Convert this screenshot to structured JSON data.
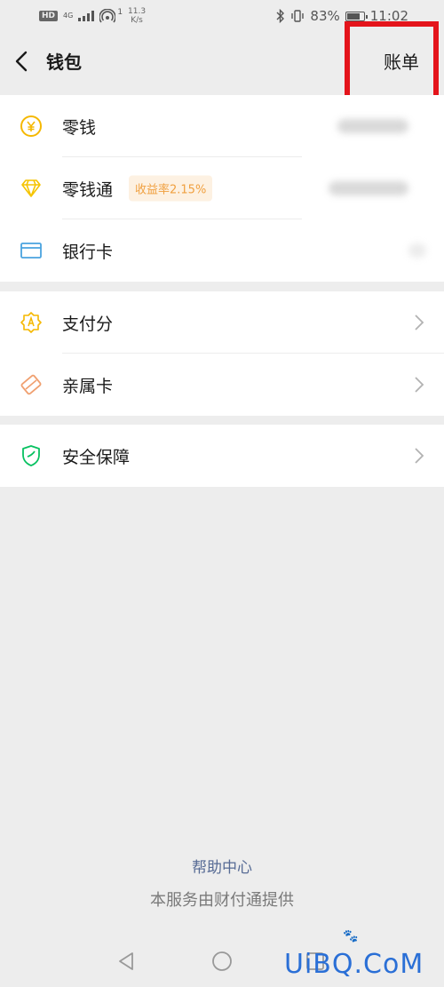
{
  "status_bar": {
    "hd": "HD",
    "network": "4G",
    "network_sub": "ᴴᴰ",
    "speed_value": "11.3",
    "speed_unit": "K/s",
    "battery_percent": "83%",
    "battery_level": 83,
    "time": "11:02",
    "hotspot_count": "1"
  },
  "header": {
    "title": "钱包",
    "bill_label": "账单"
  },
  "wallet_items": [
    {
      "label": "零钱",
      "icon": "yuan-coin-icon"
    },
    {
      "label": "零钱通",
      "icon": "diamond-icon",
      "badge": "收益率2.15%"
    },
    {
      "label": "银行卡",
      "icon": "bank-card-icon"
    }
  ],
  "service_items": [
    {
      "label": "支付分",
      "icon": "pay-score-icon"
    },
    {
      "label": "亲属卡",
      "icon": "family-card-icon"
    }
  ],
  "security_items": [
    {
      "label": "安全保障",
      "icon": "shield-icon"
    }
  ],
  "footer": {
    "help_center": "帮助中心",
    "provider_text": "本服务由财付通提供"
  },
  "watermark": "UiBQ.CoM",
  "colors": {
    "background": "#ededed",
    "highlight": "#e4141b",
    "link": "#576b95",
    "badge_text": "#f0a040",
    "badge_bg": "#fdf1e2",
    "coin": "#f5b800",
    "card": "#4aa3df",
    "shield": "#07c160",
    "family": "#f0a070"
  }
}
